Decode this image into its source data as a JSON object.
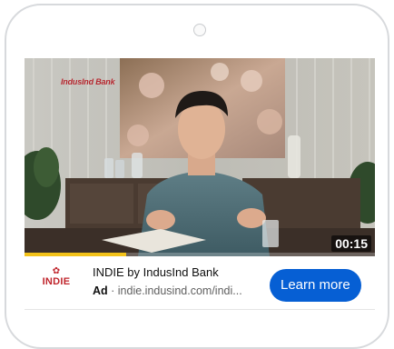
{
  "video": {
    "brand_overlay": "IndusInd Bank",
    "duration": "00:15",
    "progress": 0.29,
    "progress_color": "#f3c219"
  },
  "ad": {
    "advertiser_logo_text": "INDIE",
    "title": "INDIE by IndusInd Bank",
    "badge": "Ad",
    "separator": " · ",
    "url": "indie.indusind.com/indi...",
    "cta_label": "Learn more",
    "cta_color": "#065fd4"
  }
}
